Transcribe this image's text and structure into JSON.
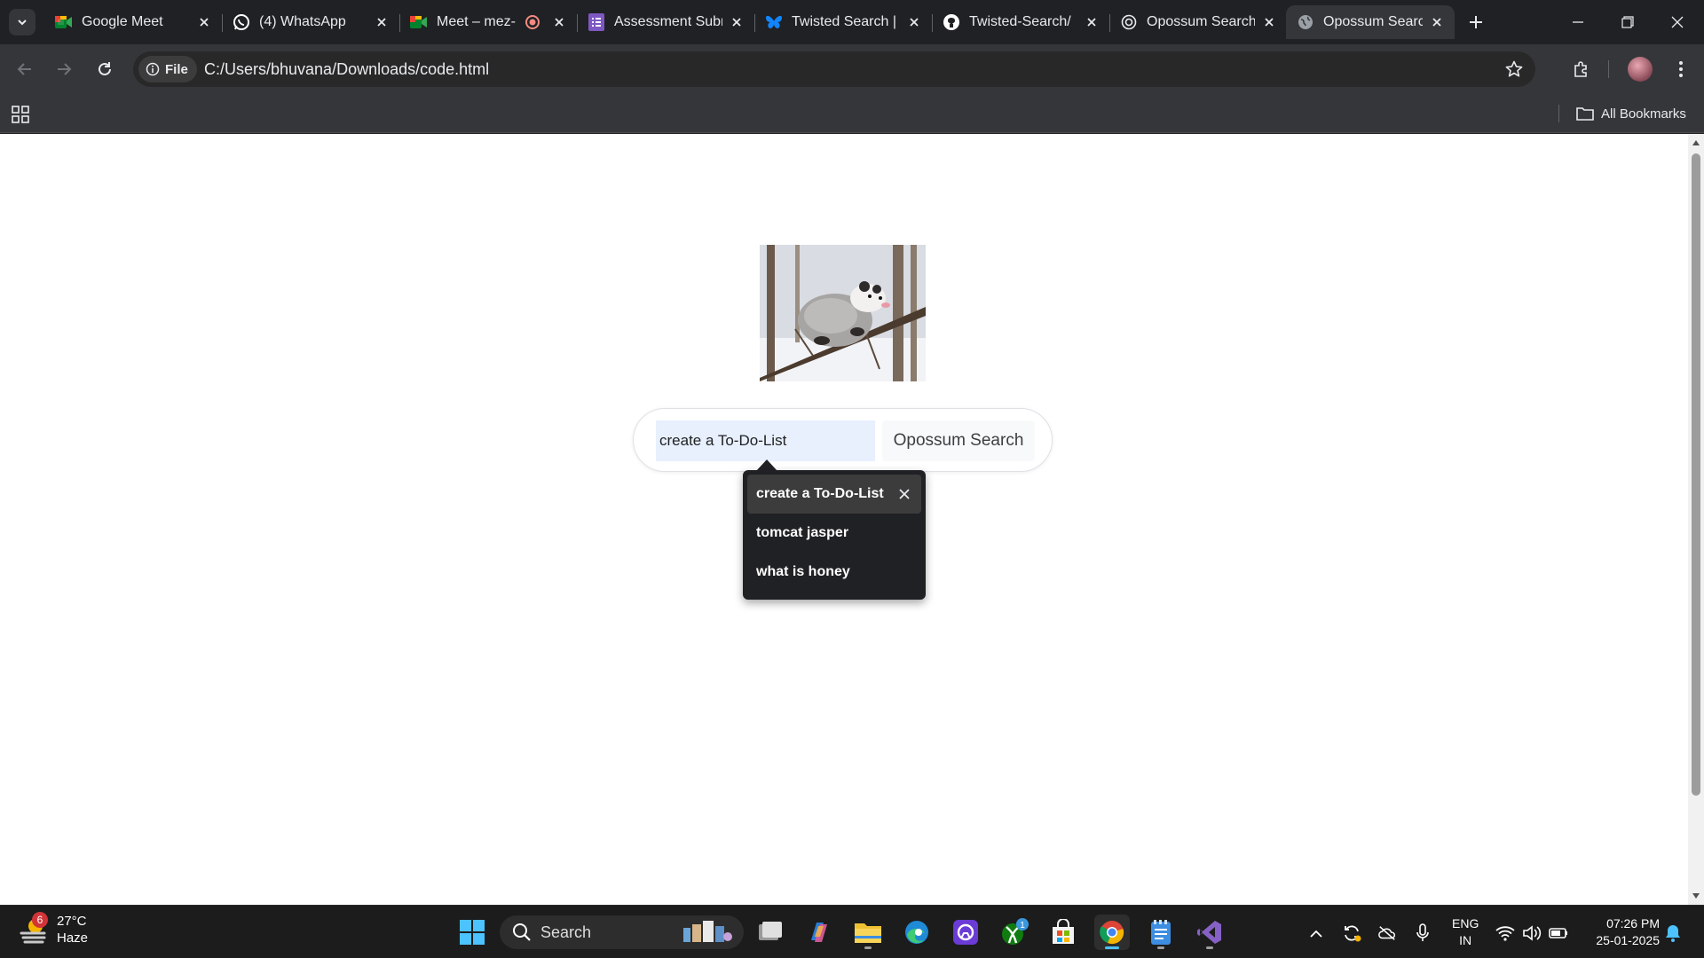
{
  "browser": {
    "tabs": [
      {
        "title": "Google Meet",
        "icon": "google-meet-icon"
      },
      {
        "title": "(4) WhatsApp",
        "icon": "whatsapp-icon"
      },
      {
        "title": "Meet – mez-",
        "icon": "google-meet-icon"
      },
      {
        "title": "Assessment Subr",
        "icon": "forms-icon"
      },
      {
        "title": "Twisted Search |",
        "icon": "butterfly-icon"
      },
      {
        "title": "Twisted-Search/",
        "icon": "github-icon"
      },
      {
        "title": "Opossum Search",
        "icon": "chatgpt-icon"
      },
      {
        "title": "Opossum Search",
        "icon": "globe-icon",
        "active": true
      }
    ],
    "security_chip": "File",
    "url": "C:/Users/bhuvana/Downloads/code.html",
    "all_bookmarks": "All Bookmarks"
  },
  "page": {
    "search_value": "create a To-Do-List",
    "search_button": "Opossum Search",
    "suggestions": [
      "create a To-Do-List",
      "tomcat jasper",
      "what is honey"
    ]
  },
  "taskbar": {
    "weather": {
      "badge": "6",
      "temp": "27°C",
      "condition": "Haze"
    },
    "search_label": "Search",
    "language": {
      "lang": "ENG",
      "region": "IN"
    },
    "time": "07:26 PM",
    "date": "25-01-2025",
    "store_badge": "1"
  },
  "colors": {
    "tab_strip": "#202124",
    "toolbar": "#35363a",
    "input_autofill": "#e8f0fe",
    "dropdown": "#202124",
    "taskbar": "#1c1c1c",
    "accent": "#4cc2ff"
  }
}
